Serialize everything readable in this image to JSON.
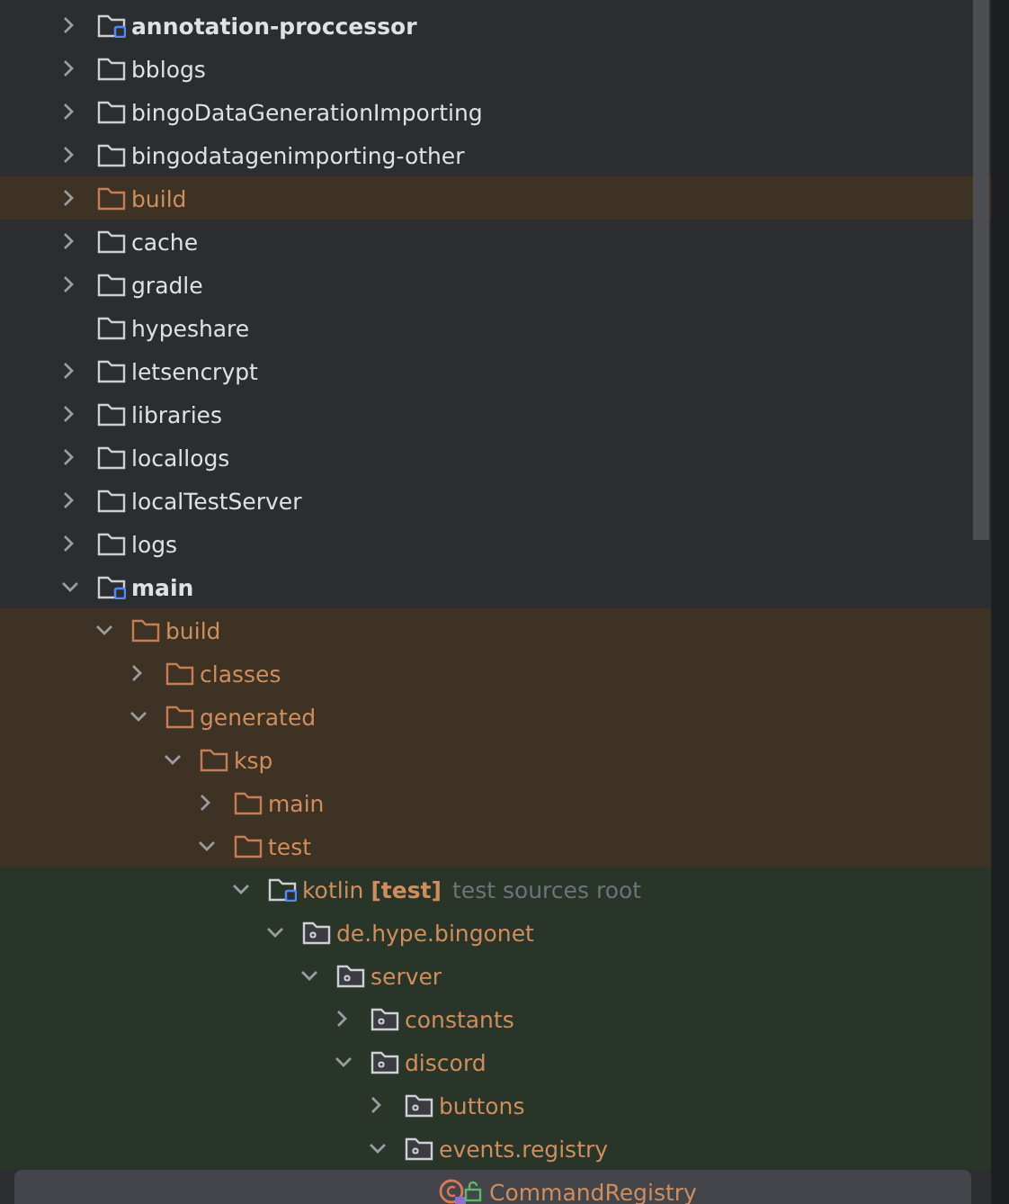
{
  "tree": [
    {
      "name": "annotation-proccessor",
      "kind": "module",
      "expanded": false,
      "selected": false
    },
    {
      "name": "bblogs",
      "kind": "folder",
      "expanded": false,
      "selected": false
    },
    {
      "name": "bingoDataGenerationImporting",
      "kind": "folder",
      "expanded": false,
      "selected": false
    },
    {
      "name": "bingodatagenimporting-other",
      "kind": "folder",
      "expanded": false,
      "selected": false
    },
    {
      "name": "build",
      "kind": "excluded",
      "expanded": false,
      "selected": false
    },
    {
      "name": "cache",
      "kind": "folder",
      "expanded": false,
      "selected": false
    },
    {
      "name": "gradle",
      "kind": "folder",
      "expanded": false,
      "selected": false
    },
    {
      "name": "hypeshare",
      "kind": "folder",
      "selected": false
    },
    {
      "name": "letsencrypt",
      "kind": "folder",
      "expanded": false,
      "selected": false
    },
    {
      "name": "libraries",
      "kind": "folder",
      "expanded": false,
      "selected": false
    },
    {
      "name": "locallogs",
      "kind": "folder",
      "expanded": false,
      "selected": false
    },
    {
      "name": "localTestServer",
      "kind": "folder",
      "expanded": false,
      "selected": false
    },
    {
      "name": "logs",
      "kind": "folder",
      "expanded": false,
      "selected": false
    },
    {
      "name": "main",
      "kind": "module",
      "expanded": true,
      "selected": false,
      "children": [
        {
          "name": "build",
          "kind": "excluded",
          "expanded": true,
          "selected": false,
          "children": [
            {
              "name": "classes",
              "kind": "folder",
              "expanded": false,
              "selected": false
            },
            {
              "name": "generated",
              "kind": "folder",
              "expanded": true,
              "selected": false,
              "children": [
                {
                  "name": "ksp",
                  "kind": "folder",
                  "expanded": true,
                  "selected": false,
                  "children": [
                    {
                      "name": "main",
                      "kind": "folder",
                      "expanded": false,
                      "selected": false
                    },
                    {
                      "name": "test",
                      "kind": "folder",
                      "expanded": true,
                      "selected": false,
                      "children": [
                        {
                          "name": "kotlin **[test]**",
                          "hint": "test sources root",
                          "kind": "source_root",
                          "expanded": true,
                          "selected": false,
                          "children": [
                            {
                              "name": "de.hype.bingonet",
                              "kind": "package",
                              "expanded": true,
                              "selected": false,
                              "children": [
                                {
                                  "name": "server",
                                  "kind": "package",
                                  "expanded": true,
                                  "selected": false,
                                  "children": [
                                    {
                                      "name": "constants",
                                      "kind": "package",
                                      "expanded": false,
                                      "selected": false
                                    },
                                    {
                                      "name": "discord",
                                      "kind": "package",
                                      "expanded": true,
                                      "selected": false,
                                      "children": [
                                        {
                                          "name": "buttons",
                                          "kind": "package",
                                          "expanded": false,
                                          "selected": false
                                        },
                                        {
                                          "name": "events.registry",
                                          "kind": "package",
                                          "expanded": true,
                                          "selected": false,
                                          "children": [
                                            {
                                              "name": "CommandRegistry",
                                              "kind": "class",
                                              "selected": true
                                            }
                                          ]
                                        }
                                      ]
                                    }
                                  ]
                                }
                              ]
                            }
                          ]
                        }
                      ]
                    }
                  ]
                }
              ]
            }
          ]
        }
      ]
    }
  ]
}
